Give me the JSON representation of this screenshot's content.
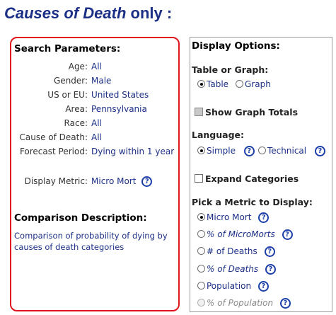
{
  "page": {
    "title_italic": "Causes of Death",
    "title_rest": " only :"
  },
  "search_parameters": {
    "heading": "Search Parameters:",
    "rows": [
      {
        "label": "Age:",
        "value": "All"
      },
      {
        "label": "Gender:",
        "value": "Male"
      },
      {
        "label": "US or EU:",
        "value": "United States"
      },
      {
        "label": "Area:",
        "value": "Pennsylvania"
      },
      {
        "label": "Race:",
        "value": "All"
      },
      {
        "label": "Cause of Death:",
        "value": "All"
      },
      {
        "label": "Forecast Period:",
        "value": "Dying within 1 year"
      }
    ],
    "display_metric": {
      "label": "Display Metric:",
      "value": "Micro Mort"
    },
    "comparison_heading": "Comparison Description:",
    "comparison_text": "Comparison of probability of dying by causes of death categories"
  },
  "display_options": {
    "heading": "Display Options:",
    "table_or_graph": {
      "label": "Table or Graph:",
      "options": [
        "Table",
        "Graph"
      ],
      "selected": "Table"
    },
    "show_graph_totals": {
      "label": "Show Graph Totals",
      "checked": false,
      "disabled": true
    },
    "language": {
      "label": "Language:",
      "options": [
        "Simple",
        "Technical"
      ],
      "selected": "Simple"
    },
    "expand_categories": {
      "label": "Expand Categories",
      "checked": false
    },
    "metric": {
      "label": "Pick a Metric to Display:",
      "options": [
        "Micro Mort",
        "% of MicroMorts",
        "# of Deaths",
        "% of Deaths",
        "Population",
        "% of Population"
      ],
      "selected": "Micro Mort"
    }
  },
  "help_icon_glyph": "?",
  "colors": {
    "accent": "#1c2f86",
    "panel_border": "#e0161c",
    "help_icon": "#1c3fa8"
  }
}
